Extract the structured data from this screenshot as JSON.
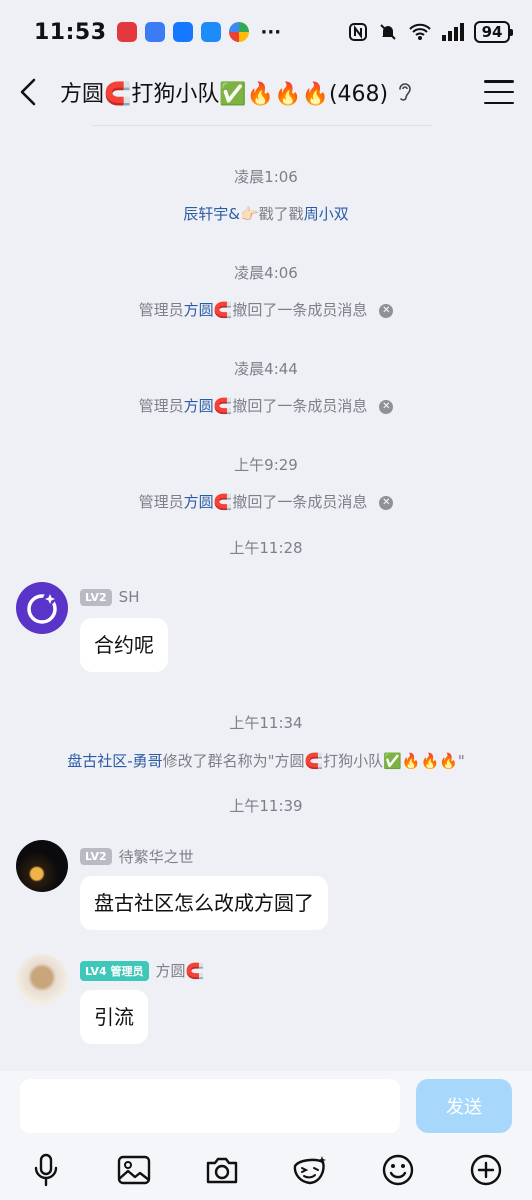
{
  "status_bar": {
    "time": "11:53",
    "battery": "94",
    "notification_icons": [
      "red-app-icon",
      "blue-app-icon",
      "blue-app-icon",
      "blue-app-icon",
      "multicolor-app-icon"
    ],
    "more": "···"
  },
  "header": {
    "title": "方圆🧲打狗小队✅🔥🔥🔥(468)"
  },
  "chat": {
    "t1": "凌晨1:06",
    "m1": {
      "actor": "辰轩宇&",
      "emoji": "👉🏻",
      "action": "戳了戳",
      "target": "周小双"
    },
    "t2": "凌晨4:06",
    "m2": {
      "prefix": "管理员",
      "name": "方圆🧲",
      "action": "撤回了一条成员消息"
    },
    "t3": "凌晨4:44",
    "m3": {
      "prefix": "管理员",
      "name": "方圆🧲",
      "action": "撤回了一条成员消息"
    },
    "t4": "上午9:29",
    "m4": {
      "prefix": "管理员",
      "name": "方圆🧲",
      "action": "撤回了一条成员消息"
    },
    "t5": "上午11:28",
    "msg1": {
      "level": "LV2",
      "sender": "SH",
      "text": "合约呢"
    },
    "t6": "上午11:34",
    "m5": {
      "actor": "盘古社区-勇哥",
      "action": "修改了群名称为\"方圆🧲打狗小队✅🔥🔥🔥\""
    },
    "t7": "上午11:39",
    "msg2": {
      "level": "LV2",
      "sender": "待繁华之世",
      "text": "盘古社区怎么改成方圆了"
    },
    "msg3": {
      "level": "LV4 管理员",
      "sender": "方圆🧲",
      "text": "引流"
    }
  },
  "input": {
    "value": "",
    "send_label": "发送"
  },
  "toolbar": [
    "microphone-icon",
    "image-icon",
    "camera-icon",
    "sticker-icon",
    "emoji-icon",
    "plus-icon"
  ],
  "colors": {
    "background": "#eef0f5",
    "link": "#2b5ca6",
    "send_button": "#a7d8fb",
    "admin_badge": "#3fc7b9"
  }
}
